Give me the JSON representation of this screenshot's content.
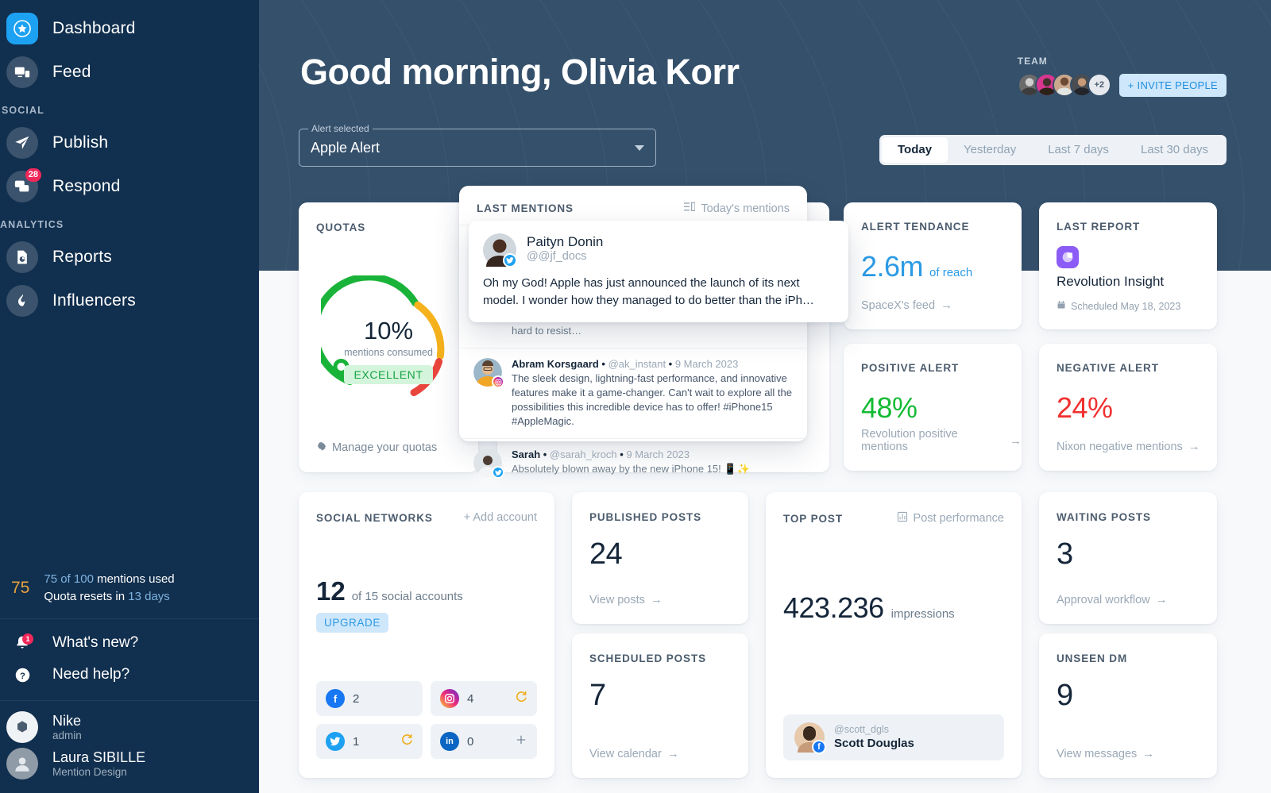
{
  "sidebar": {
    "nav": [
      {
        "label": "Dashboard",
        "icon": "star-badge-icon",
        "active": true
      },
      {
        "label": "Feed",
        "icon": "devices-feed-icon",
        "active": false
      }
    ],
    "sections": [
      {
        "label": "SOCIAL",
        "items": [
          {
            "label": "Publish",
            "icon": "paper-plane-icon",
            "badge": ""
          },
          {
            "label": "Respond",
            "icon": "chat-bubbles-icon",
            "badge": "28"
          }
        ]
      },
      {
        "label": "ANALYTICS",
        "items": [
          {
            "label": "Reports",
            "icon": "report-document-icon",
            "badge": ""
          },
          {
            "label": "Influencers",
            "icon": "flame-icon",
            "badge": ""
          }
        ]
      }
    ],
    "quota": {
      "number": "75",
      "line1_used": "75 of 100",
      "line1_rest": " mentions used",
      "line2_pre": "Quota resets in ",
      "line2_days": "13 days"
    },
    "help": [
      {
        "label": "What's new?",
        "icon": "bell-icon",
        "badge": "1"
      },
      {
        "label": "Need help?",
        "icon": "question-circle-icon",
        "badge": ""
      }
    ],
    "accounts": [
      {
        "name": "Nike",
        "sub": "admin",
        "icon": "nike-workspace-icon"
      },
      {
        "name": "Laura SIBILLE",
        "sub": "Mention Design",
        "icon": "user-avatar-icon"
      }
    ]
  },
  "header": {
    "greeting": "Good morning, Olivia Korr",
    "alert_select": {
      "legend": "Alert selected",
      "value": "Apple Alert"
    },
    "team": {
      "label": "TEAM",
      "more": "+2",
      "invite_label": "+ INVITE PEOPLE"
    },
    "ranges": [
      {
        "label": "Today",
        "active": true
      },
      {
        "label": "Yesterday",
        "active": false
      },
      {
        "label": "Last 7 days",
        "active": false
      },
      {
        "label": "Last 30 days",
        "active": false
      }
    ]
  },
  "quotas": {
    "title": "QUOTAS",
    "percent": "10%",
    "sub": "mentions consumed",
    "tag": "EXCELLENT",
    "manage_link": "Manage your quotas",
    "gear_icon": "gear-icon"
  },
  "mentions": {
    "title": "LAST MENTIONS",
    "link": "Today's mentions",
    "link_icon": "list-icon",
    "highlight": {
      "name": "Paityn Donin",
      "handle": "@@jf_docs",
      "network": "twitter",
      "text": "Oh my God! Apple has just announced the launch of its next model. I wonder how they managed to do better than the iPh…"
    },
    "items": [
      {
        "name": "",
        "handle": "",
        "date": "",
        "network": "facebook",
        "text": "Lorem between Apple and Samsung my heart sways… With the new announcement, I have a feeling I'm going to find it hard to resist…"
      },
      {
        "name": "Abram Korsgaard",
        "handle": "@ak_instant",
        "date": "9 March 2023",
        "network": "instagram",
        "text": "The sleek design, lightning-fast performance, and innovative features make it a game-changer. Can't wait to explore all the possibilities this incredible device has to offer! #iPhone15 #AppleMagic."
      },
      {
        "name": "Sarah",
        "handle": "@sarah_kroch",
        "date": "9 March 2023",
        "network": "twitter",
        "text": "Absolutely blown away by the new iPhone 15! 📱✨"
      }
    ]
  },
  "metrics": {
    "alert_tendance": {
      "title": "ALERT TENDANCE",
      "value": "2.6m",
      "unit": "of reach",
      "link": "SpaceX's feed",
      "color": "#2b9ae5"
    },
    "last_report": {
      "title": "LAST REPORT",
      "name": "Revolution Insight",
      "scheduled": "Scheduled May 18, 2023",
      "calendar_icon": "calendar-icon",
      "color": "#8b5cf6"
    },
    "positive_alert": {
      "title": "POSITIVE ALERT",
      "value": "48%",
      "link": "Revolution positive mentions",
      "color": "#14bb34"
    },
    "negative_alert": {
      "title": "NEGATIVE ALERT",
      "value": "24%",
      "link": "Nixon negative mentions",
      "color": "#f0302f"
    }
  },
  "social_networks": {
    "title": "SOCIAL NETWORKS",
    "add_label": "+ Add account",
    "count": "12",
    "count_sub": "of 15 social accounts",
    "upgrade": "UPGRADE",
    "cells": [
      {
        "network": "facebook",
        "count": "2",
        "action": ""
      },
      {
        "network": "instagram",
        "count": "4",
        "action": "refresh"
      },
      {
        "network": "twitter",
        "count": "1",
        "action": "refresh"
      },
      {
        "network": "linkedin",
        "count": "0",
        "action": "plus"
      }
    ]
  },
  "published_posts": {
    "title": "PUBLISHED POSTS",
    "value": "24",
    "link": "View posts"
  },
  "scheduled_posts": {
    "title": "SCHEDULED POSTS",
    "value": "7",
    "link": "View calendar"
  },
  "top_post": {
    "title": "TOP POST",
    "link": "Post performance",
    "link_icon": "bar-chart-icon",
    "value": "423.236",
    "unit": "impressions",
    "author_handle": "@scott_dgls",
    "author_name": "Scott Douglas",
    "author_network": "facebook"
  },
  "waiting_posts": {
    "title": "WAITING POSTS",
    "value": "3",
    "link": "Approval workflow"
  },
  "unseen_dm": {
    "title": "UNSEEN DM",
    "value": "9",
    "link": "View messages"
  }
}
